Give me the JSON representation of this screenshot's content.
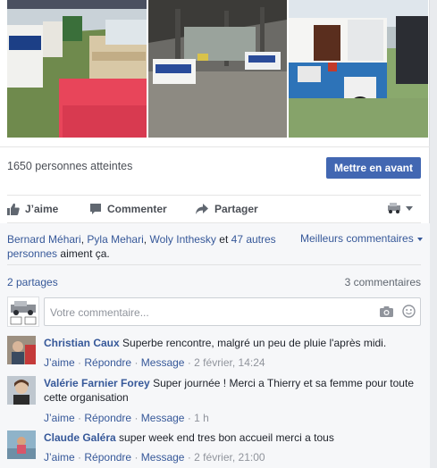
{
  "post": {
    "reach_text": "1650 personnes atteintes",
    "boost_label": "Mettre en avant"
  },
  "actions": {
    "like": "J’aime",
    "comment": "Commenter",
    "share": "Partager"
  },
  "likes_summary": {
    "names": [
      "Bernard Méhari",
      "Pyla Mehari",
      "Woly Inthesky"
    ],
    "conj": "et",
    "others": "47 autres personnes",
    "suffix": "aiment ça.",
    "sep": ","
  },
  "sort_label": "Meilleurs commentaires",
  "shares_count": "2 partages",
  "comments_count": "3 commentaires",
  "composer": {
    "placeholder": "Votre commentaire..."
  },
  "meta_labels": {
    "like": "J’aime",
    "reply": "Répondre",
    "message": "Message",
    "dot": "·"
  },
  "comments": [
    {
      "author": "Christian Caux",
      "text": "Superbe rencontre, malgré un peu de pluie l'après midi.",
      "time": "2 février, 14:24"
    },
    {
      "author": "Valérie Farnier Forey",
      "text": "Super journée ! Merci a Thierry et sa femme pour toute cette organisation",
      "time": "1 h"
    },
    {
      "author": "Claude Galéra",
      "text": "super week end tres bon accueil merci a tous",
      "time": "2 février, 21:00"
    }
  ],
  "colors": {
    "brand": "#4267b2",
    "link": "#365899",
    "meta": "#90949c"
  }
}
